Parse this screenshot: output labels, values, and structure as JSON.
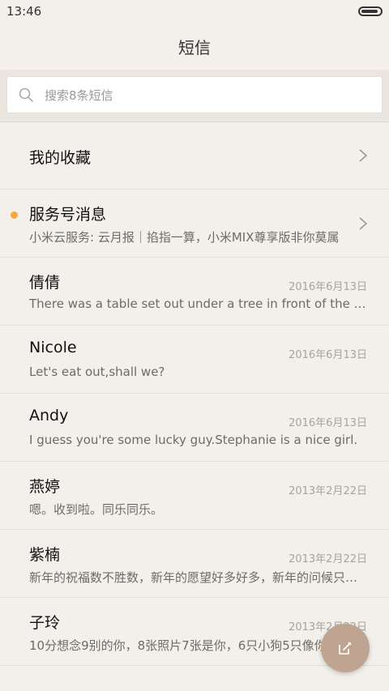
{
  "status": {
    "time": "13:46"
  },
  "header": {
    "title": "短信"
  },
  "search": {
    "placeholder": "搜索8条短信"
  },
  "favorites": {
    "label": "我的收藏"
  },
  "service": {
    "title": "服务号消息",
    "snippet": "小米云服务: 云月报｜掐指一算，小米MIX尊享版非你莫属"
  },
  "conversations": [
    {
      "name": "倩倩",
      "date": "2016年6月13日",
      "snippet": "There was a table set out under a tree in front of the house"
    },
    {
      "name": "Nicole",
      "date": "2016年6月13日",
      "snippet": "Let's eat out,shall we?"
    },
    {
      "name": "Andy",
      "date": "2016年6月13日",
      "snippet": "I guess you're some lucky guy.Stephanie is a nice girl."
    },
    {
      "name": "燕婷",
      "date": "2013年2月22日",
      "snippet": "嗯。收到啦。同乐同乐。"
    },
    {
      "name": "紫楠",
      "date": "2013年2月22日",
      "snippet": "新年的祝福数不胜数，新年的愿望好多好多，新年的问候只有一句"
    },
    {
      "name": "子玲",
      "date": "2013年2月22日",
      "snippet": "10分想念9别的你，8张照片7张是你，6只小狗5只像你"
    }
  ],
  "colors": {
    "unread_dot": "#f5a940",
    "fab": "#bfa492",
    "background": "#f3f0eb"
  },
  "icons": {
    "search": "search-icon",
    "chevron": "chevron-right-icon",
    "compose": "compose-icon"
  }
}
